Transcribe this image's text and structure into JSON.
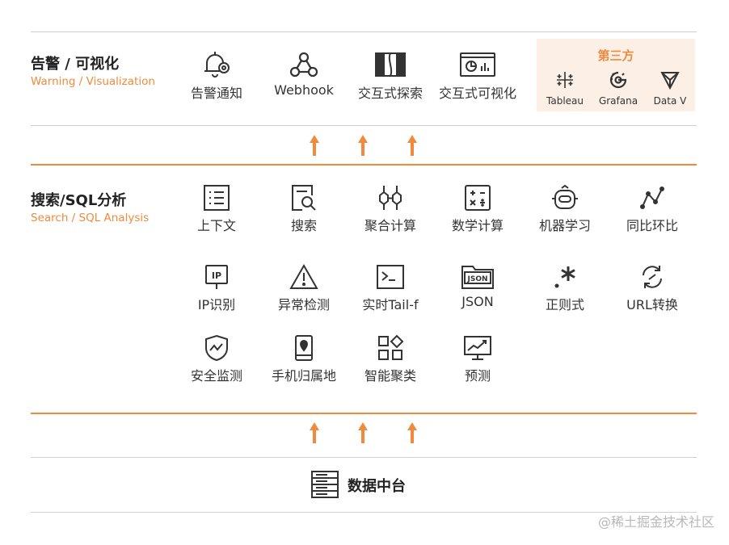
{
  "alert": {
    "title": "告警 / 可视化",
    "subtitle": "Warning / Visualization",
    "items": [
      "告警通知",
      "Webhook",
      "交互式探索",
      "交互式可视化"
    ],
    "icons": [
      "alarm-gear-icon",
      "webhook-icon",
      "explore-icon",
      "dashboard-icon"
    ]
  },
  "third_party": {
    "title": "第三方",
    "items": [
      "Tableau",
      "Grafana",
      "Data V"
    ],
    "icons": [
      "tableau-icon",
      "grafana-icon",
      "datav-icon"
    ]
  },
  "search": {
    "title": "搜索/SQL分析",
    "subtitle": "Search / SQL Analysis",
    "items": [
      "上下文",
      "搜索",
      "聚合计算",
      "数学计算",
      "机器学习",
      "同比环比",
      "IP识别",
      "异常检测",
      "实时Tail-f",
      "JSON",
      "正则式",
      "URL转换",
      "安全监测",
      "手机归属地",
      "智能聚类",
      "预测"
    ],
    "icons": [
      "list-icon",
      "search-doc-icon",
      "aggregate-icon",
      "calculator-icon",
      "robot-icon",
      "trend-icon",
      "ip-icon",
      "warning-icon",
      "terminal-icon",
      "json-folder-icon",
      "regex-icon",
      "url-convert-icon",
      "shield-icon",
      "mobile-location-icon",
      "cluster-icon",
      "forecast-icon"
    ],
    "json_badge": "JSON",
    "ip_badge": "IP"
  },
  "footer": {
    "title": "数据中台",
    "icon": "server-icon"
  },
  "watermark": "@稀土掘金技术社区",
  "colors": {
    "accent": "#f08a3c",
    "line": "#cfcfcf",
    "third_party_bg": "#fcefe5"
  }
}
